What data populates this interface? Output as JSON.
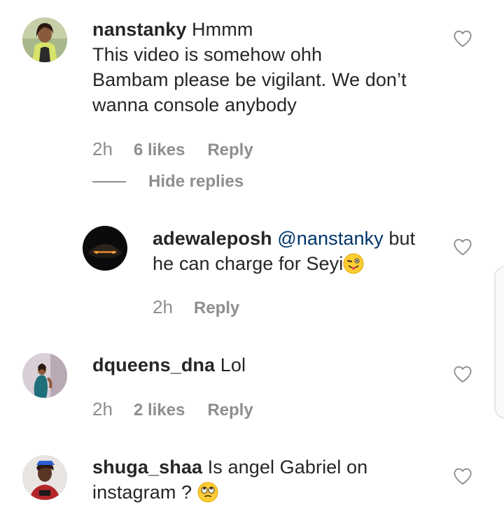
{
  "comments": [
    {
      "username": "nanstanky",
      "text_line1": " Hmmm",
      "text_line2": "This video is somehow ohh",
      "text_line3": "Bambam please be vigilant. We don’t",
      "text_line4": "wanna console anybody",
      "time": "2h",
      "likes": "6 likes",
      "reply": "Reply",
      "hide_replies": "Hide replies",
      "avatar_icon": "woman-portrait-avatar"
    },
    {
      "username": "adewaleposh",
      "mention": "@nanstanky",
      "text_line1_rest": " but",
      "text_line2": "he can charge for Seyi",
      "emoji": "winking-face-with-tongue",
      "time": "2h",
      "reply": "Reply",
      "avatar_icon": "dark-car-avatar"
    },
    {
      "username": "dqueens_dna",
      "text_line1": " Lol",
      "time": "2h",
      "likes": "2 likes",
      "reply": "Reply",
      "avatar_icon": "woman-teal-dress-avatar"
    },
    {
      "username": "shuga_shaa",
      "text_line1": " Is angel Gabriel on",
      "text_line2": "instagram ? ",
      "emoji": "face-with-rolling-eyes",
      "avatar_icon": "man-portrait-avatar"
    }
  ],
  "icons": {
    "like": "heart-outline-icon"
  },
  "colors": {
    "text": "#262626",
    "muted": "#8e8e8e",
    "mention": "#003569"
  }
}
